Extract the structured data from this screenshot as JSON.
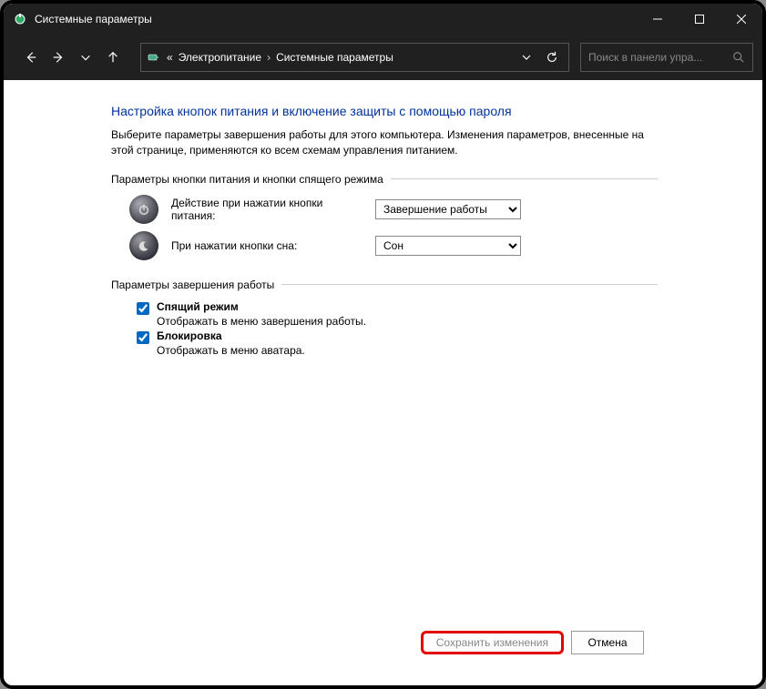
{
  "window": {
    "title": "Системные параметры"
  },
  "breadcrumb": {
    "prefix": "«",
    "item1": "Электропитание",
    "item2": "Системные параметры"
  },
  "search": {
    "placeholder": "Поиск в панели упра..."
  },
  "page": {
    "heading": "Настройка кнопок питания и включение защиты с помощью пароля",
    "description": "Выберите параметры завершения работы для этого компьютера. Изменения параметров, внесенные на этой странице, применяются ко всем схемам управления питанием."
  },
  "group1": {
    "title": "Параметры кнопки питания и кнопки спящего режима",
    "power_label": "Действие при нажатии кнопки питания:",
    "power_value": "Завершение работы",
    "sleep_label": "При нажатии кнопки сна:",
    "sleep_value": "Сон"
  },
  "group2": {
    "title": "Параметры завершения работы",
    "opt1_label": "Спящий режим",
    "opt1_sub": "Отображать в меню завершения работы.",
    "opt2_label": "Блокировка",
    "opt2_sub": "Отображать в меню аватара."
  },
  "footer": {
    "save": "Сохранить изменения",
    "cancel": "Отмена"
  }
}
